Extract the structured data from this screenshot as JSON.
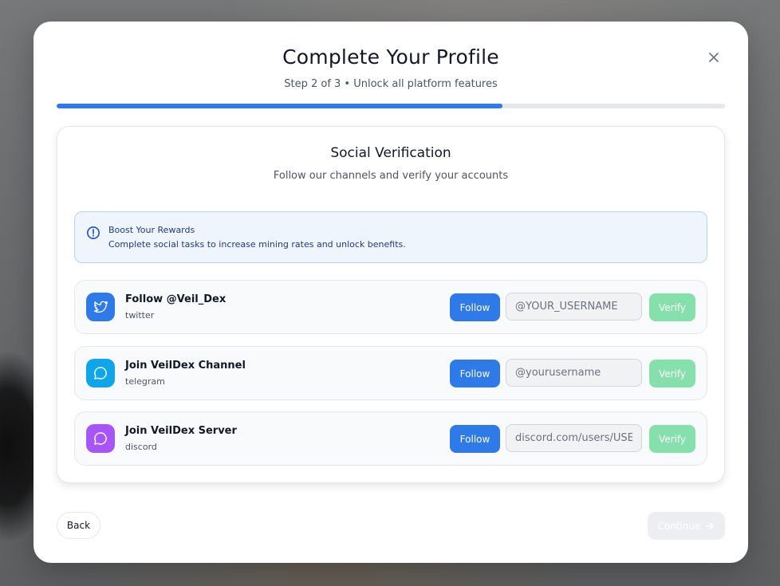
{
  "modal": {
    "title": "Complete Your Profile",
    "subtitle": "Step 2 of 3 • Unlock all platform features",
    "progress_fraction": 0.667
  },
  "section": {
    "title": "Social Verification",
    "subtitle": "Follow our channels and verify your accounts"
  },
  "info": {
    "title": "Boost Your Rewards",
    "text": "Complete social tasks to increase mining rates and unlock benefits."
  },
  "tasks": [
    {
      "title": "Follow @Veil_Dex",
      "platform": "twitter",
      "follow_label": "Follow",
      "placeholder": "@YOUR_USERNAME",
      "verify_label": "Verify",
      "icon": "twitter-icon",
      "color": "#2d7ae8"
    },
    {
      "title": "Join VeilDex Channel",
      "platform": "telegram",
      "follow_label": "Follow",
      "placeholder": "@yourusername",
      "verify_label": "Verify",
      "icon": "chat-bubble-icon",
      "color": "#0ea5e9"
    },
    {
      "title": "Join VeilDex Server",
      "platform": "discord",
      "follow_label": "Follow",
      "placeholder": "discord.com/users/USERID",
      "verify_label": "Verify",
      "icon": "chat-bubble-icon",
      "color": "#a855f7"
    }
  ],
  "footer": {
    "back_label": "Back",
    "continue_label": "Continue"
  },
  "colors": {
    "primary": "#2d7ae8",
    "verify_disabled": "#86e0ab"
  }
}
